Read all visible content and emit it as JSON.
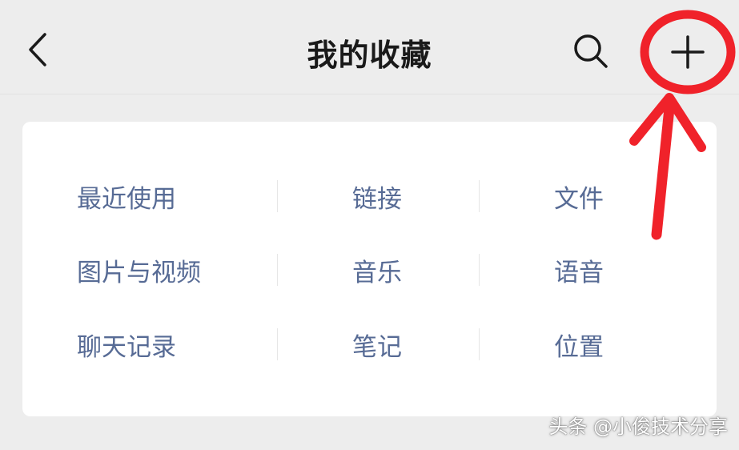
{
  "navbar": {
    "title": "我的收藏",
    "back_icon": "chevron-left",
    "search_icon": "magnifier",
    "add_icon": "plus"
  },
  "categories": {
    "rows": [
      [
        "最近使用",
        "链接",
        "文件"
      ],
      [
        "图片与视频",
        "音乐",
        "语音"
      ],
      [
        "聊天记录",
        "笔记",
        "位置"
      ]
    ]
  },
  "annotation": {
    "color": "#f0222a",
    "shape": "circle-and-arrow",
    "target": "add-button"
  },
  "watermark": {
    "text": "头条 @小俊技术分享"
  },
  "colors": {
    "background": "#ededed",
    "card": "#ffffff",
    "category_text": "#576b95",
    "title_text": "#1a1a1a"
  }
}
